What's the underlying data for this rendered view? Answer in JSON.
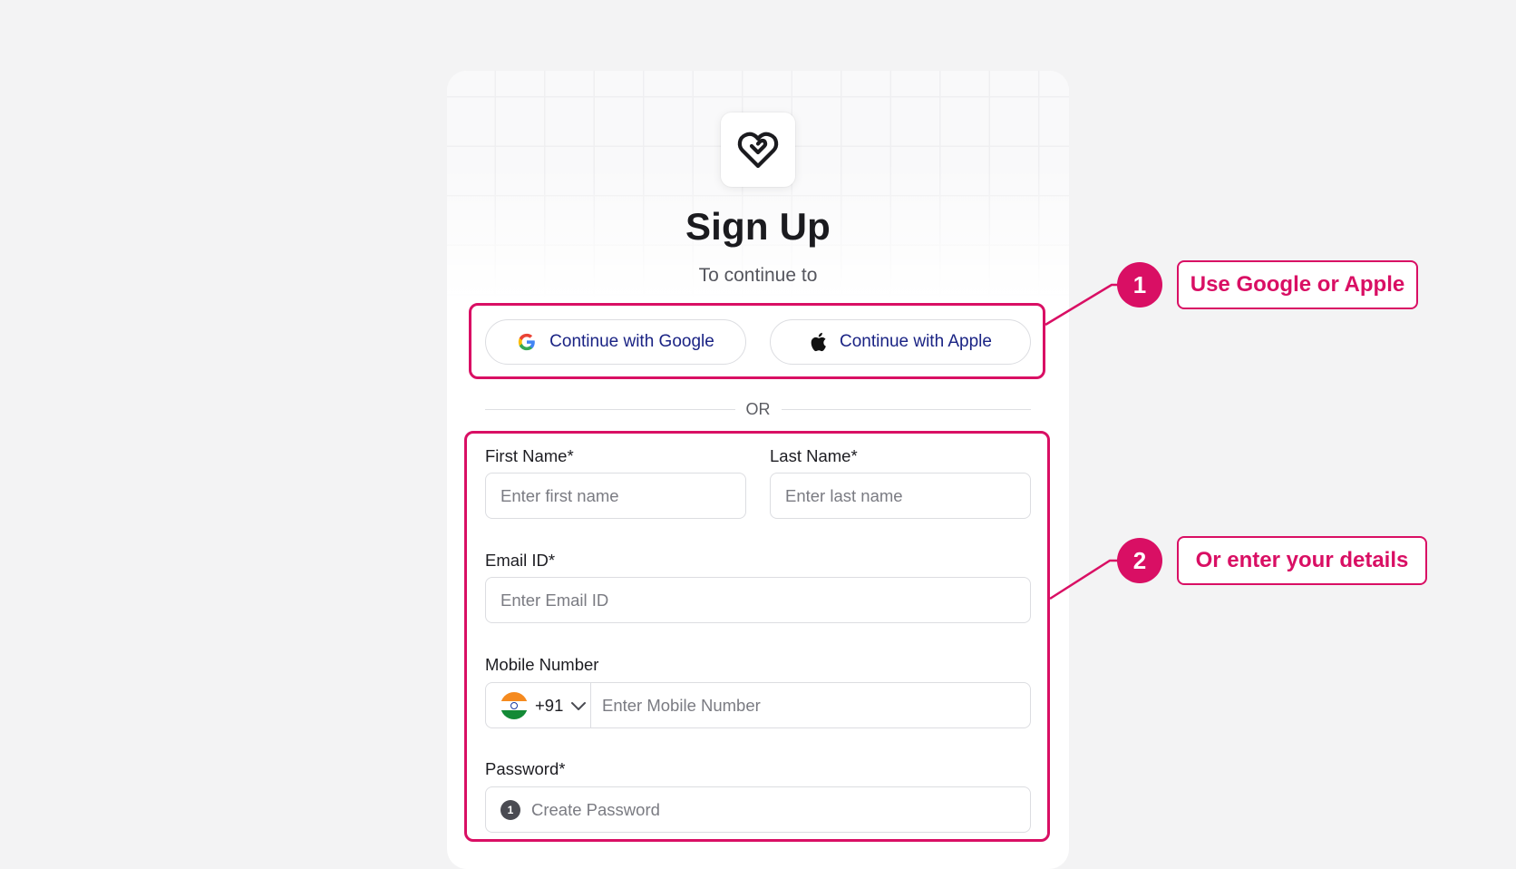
{
  "header": {
    "title": "Sign Up",
    "subtitle": "To continue to"
  },
  "oauth": {
    "google_label": "Continue with Google",
    "apple_label": "Continue with Apple"
  },
  "divider": {
    "text": "OR"
  },
  "form": {
    "first_name": {
      "label": "First Name*",
      "placeholder": "Enter first name"
    },
    "last_name": {
      "label": "Last Name*",
      "placeholder": "Enter last name"
    },
    "email": {
      "label": "Email ID*",
      "placeholder": "Enter Email ID"
    },
    "mobile": {
      "label": "Mobile Number",
      "dial_code": "+91",
      "placeholder": "Enter Mobile Number"
    },
    "password": {
      "label": "Password*",
      "icon_glyph": "1",
      "placeholder": "Create Password"
    }
  },
  "annotations": [
    {
      "number": "1",
      "text": "Use Google or Apple"
    },
    {
      "number": "2",
      "text": "Or enter your details"
    }
  ],
  "colors": {
    "accent": "#d90f64",
    "button_text": "#1a2384",
    "background": "#f3f3f4"
  },
  "icons": {
    "logo": "heart-link-logo-icon",
    "google": "google-icon",
    "apple": "apple-icon",
    "flag": "india-flag-icon",
    "chevron": "chevron-down-icon",
    "password": "info-circle-icon"
  }
}
